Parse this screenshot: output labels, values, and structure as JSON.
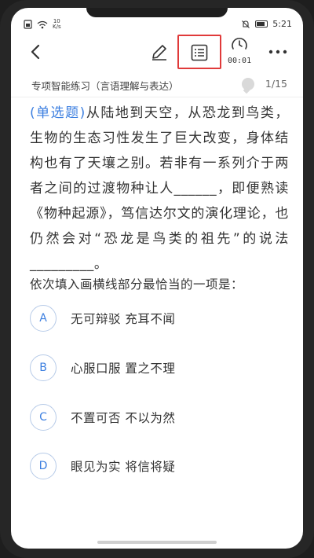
{
  "status_bar": {
    "net_speed_value": "10",
    "net_speed_unit": "K/s",
    "time": "5:21"
  },
  "toolbar": {
    "timer": "00:01"
  },
  "subheader": {
    "title": "专项智能练习（言语理解与表达）",
    "progress": "1/15"
  },
  "question": {
    "type_label": "(单选题)",
    "text": "从陆地到天空，从恐龙到鸟类，生物的生态习性发生了巨大改变，身体结构也有了天壤之别。若非有一系列介于两者之间的过渡物种让人______，即便熟读《物种起源》，笃信达尔文的演化理论，也仍然会对“恐龙是鸟类的祖先”的说法_________。",
    "prompt": "依次填入画横线部分最恰当的一项是："
  },
  "options": [
    {
      "letter": "A",
      "text": "无可辩驳  充耳不闻"
    },
    {
      "letter": "B",
      "text": "心服口服  置之不理"
    },
    {
      "letter": "C",
      "text": "不置可否  不以为然"
    },
    {
      "letter": "D",
      "text": "眼见为实  将信将疑"
    }
  ],
  "colors": {
    "accent": "#3c7fe0",
    "highlight_box": "#e03a3a"
  },
  "icons": {
    "back": "chevron-left-icon",
    "edit": "pencil-icon",
    "answer_sheet": "list-icon",
    "timer": "stopwatch-icon",
    "more": "more-dots-icon"
  }
}
